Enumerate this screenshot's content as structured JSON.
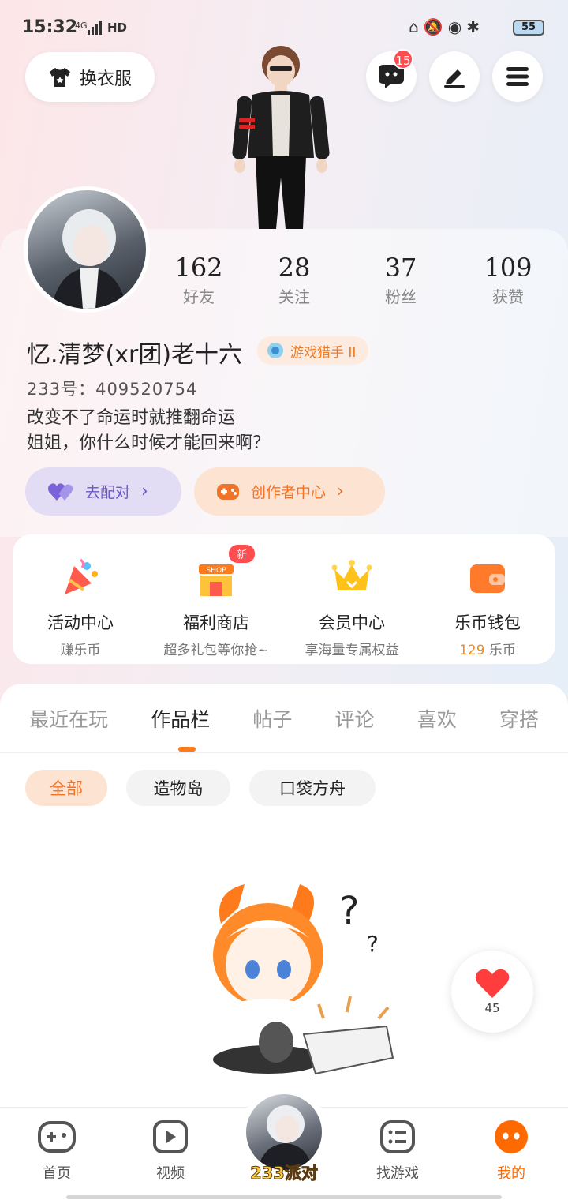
{
  "status": {
    "time": "15:32",
    "network": "4G",
    "hd": "HD",
    "battery": "55"
  },
  "top": {
    "outfit_label": "换衣服",
    "message_badge": "15"
  },
  "profile": {
    "stats": [
      {
        "value": "162",
        "label": "好友"
      },
      {
        "value": "28",
        "label": "关注"
      },
      {
        "value": "37",
        "label": "粉丝"
      },
      {
        "value": "109",
        "label": "获赞"
      }
    ],
    "name": "忆.清梦(xr团)老十六",
    "tag": "游戏猎手 II",
    "uid": "233号：409520754",
    "bio_lines": [
      "改变不了命运时就推翻命运",
      "姐姐，你什么时候才能回来啊？"
    ],
    "match_button": "去配对",
    "creator_button": "创作者中心"
  },
  "menu": [
    {
      "title": "活动中心",
      "sub": "赚乐币"
    },
    {
      "title": "福利商店",
      "sub": "超多礼包等你抢~",
      "badge": "新"
    },
    {
      "title": "会员中心",
      "sub": "享海量专属权益"
    },
    {
      "title": "乐币钱包",
      "sub_value": "129",
      "sub_unit": " 乐币"
    }
  ],
  "tabs": [
    "最近在玩",
    "作品栏",
    "帖子",
    "评论",
    "喜欢",
    "穿搭"
  ],
  "active_tab": "作品栏",
  "chips": [
    "全部",
    "造物岛",
    "口袋方舟"
  ],
  "like_count": "45",
  "nav": [
    {
      "label": "首页"
    },
    {
      "label": "视频"
    },
    {
      "label": "233派对"
    },
    {
      "label": "找游戏"
    },
    {
      "label": "我的"
    }
  ],
  "colors": {
    "accent": "#ff6a00",
    "purple": "#6b55c9",
    "badge": "#ff4d4f"
  }
}
